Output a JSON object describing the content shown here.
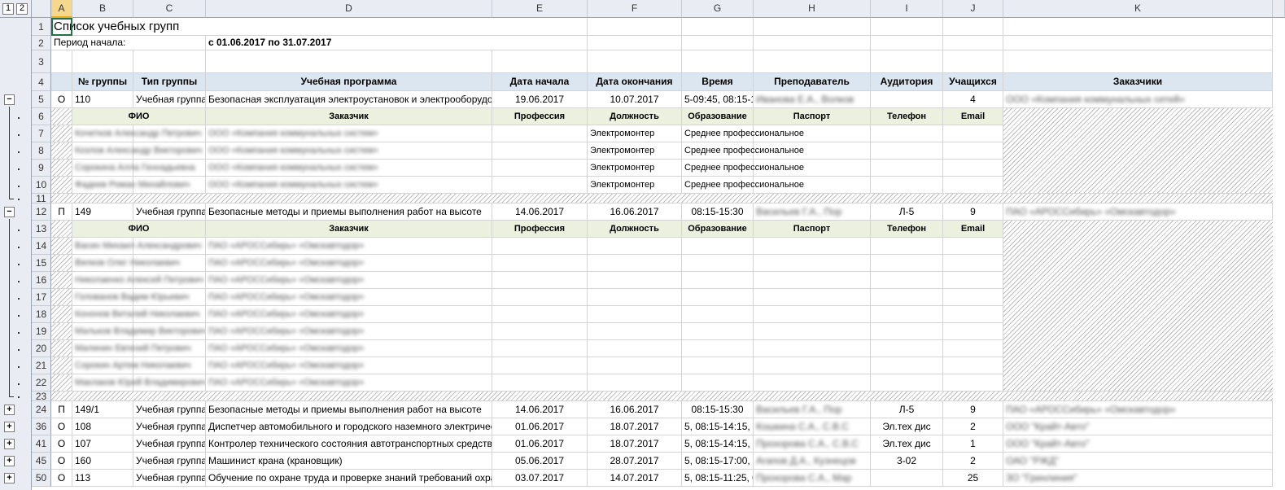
{
  "sheet": {
    "outline_levels": [
      "1",
      "2"
    ],
    "columns": [
      "A",
      "B",
      "C",
      "D",
      "E",
      "F",
      "G",
      "H",
      "I",
      "J",
      "K"
    ],
    "title": "Список учебных групп",
    "period_label": "Период начала:",
    "period_value": "с 01.06.2017 по 31.07.2017",
    "headers": [
      "№ группы",
      "Тип группы",
      "Учебная программа",
      "Дата начала",
      "Дата окончания",
      "Время",
      "Преподаватель",
      "Аудитория",
      "Учащихся",
      "Заказчики"
    ],
    "sub_headers": {
      "fio": "ФИО",
      "customer": "Заказчик",
      "profession": "Профессия",
      "position": "Должность",
      "education": "Образование",
      "passport": "Паспорт",
      "phone": "Телефон",
      "email": "Email"
    },
    "groups": [
      {
        "row": "5",
        "a": "О",
        "num": "110",
        "type": "Учебная группа",
        "program": "Безопасная эксплуатация электроустановок и электрооборудования",
        "start": "19.06.2017",
        "end": "10.07.2017",
        "time": "5-09:45, 08:15-1",
        "teacher": "Иванова Е.А., Волков",
        "room": "",
        "count": "4",
        "customer": "ООО «Компания коммунальных сетей»"
      },
      {
        "row": "12",
        "a": "П",
        "num": "149",
        "type": "Учебная группа",
        "program": "Безопасные методы и приемы выполнения работ на высоте",
        "start": "14.06.2017",
        "end": "16.06.2017",
        "time": "08:15-15:30",
        "teacher": "Васильев Г.А., Пор",
        "room": "Л-5",
        "count": "9",
        "customer": "ПАО «АРОССибирь» «Омскавтодор»"
      },
      {
        "row": "24",
        "a": "П",
        "num": "149/1",
        "type": "Учебная группа",
        "program": "Безопасные методы и приемы выполнения работ на высоте",
        "start": "14.06.2017",
        "end": "16.06.2017",
        "time": "08:15-15:30",
        "teacher": "Васильев Г.А., Пор",
        "room": "Л-5",
        "count": "9",
        "customer": "ПАО «АРОССибирь» «Омскавтодор»"
      },
      {
        "row": "36",
        "a": "О",
        "num": "108",
        "type": "Учебная группа",
        "program": "Диспетчер автомобильного и городского наземного электрического транспорта",
        "start": "01.06.2017",
        "end": "18.07.2017",
        "time": "5, 08:15-14:15, 0",
        "teacher": "Кошкина С.А., С.В.С",
        "room": "Эл.тех дис",
        "count": "2",
        "customer": "ООО \"Крайт-Авто\""
      },
      {
        "row": "41",
        "a": "О",
        "num": "107",
        "type": "Учебная группа",
        "program": "Контролер технического состояния автотранспортных средств",
        "start": "01.06.2017",
        "end": "18.07.2017",
        "time": "5, 08:15-14:15, 0",
        "teacher": "Прохорова С.А., С.В.С",
        "room": "Эл.тех дис",
        "count": "1",
        "customer": "ООО \"Крайт-Авто\""
      },
      {
        "row": "45",
        "a": "О",
        "num": "160",
        "type": "Учебная группа",
        "program": "Машинист  крана (крановщик)",
        "start": "05.06.2017",
        "end": "28.07.2017",
        "time": "5, 08:15-17:00, 0",
        "teacher": "Агапов Д.А., Кузнецов",
        "room": "3-02",
        "count": "2",
        "customer": "ОАО \"РЖД\""
      },
      {
        "row": "50",
        "a": "О",
        "num": "113",
        "type": "Учебная группа",
        "program": "Обучение по охране труда и проверке знаний требований охраны труда",
        "start": "03.07.2017",
        "end": "14.07.2017",
        "time": "5, 08:15-11:25, 0",
        "teacher": "Прохорова С.А., Мар",
        "room": "",
        "count": "25",
        "customer": "ЗО \"Гринлиния\""
      }
    ],
    "members_group1": [
      {
        "row": "7",
        "fio": "Кочетков Александр Петрович",
        "customer": "ООО «Компания коммунальных систем»",
        "position": "Электромонтер",
        "education": "Среднее профессиональное"
      },
      {
        "row": "8",
        "fio": "Козлов Александр Викторович",
        "customer": "ООО «Компания коммунальных систем»",
        "position": "Электромонтер",
        "education": "Среднее профессиональное"
      },
      {
        "row": "9",
        "fio": "Сорокина Алла Геннадьевна",
        "customer": "ООО «Компания коммунальных систем»",
        "position": "Электромонтер",
        "education": "Среднее профессиональное"
      },
      {
        "row": "10",
        "fio": "Фадеев Роман Михайлович",
        "customer": "ООО «Компания коммунальных систем»",
        "position": "Электромонтер",
        "education": "Среднее профессиональное"
      }
    ],
    "members_group2": [
      {
        "row": "14",
        "fio": "Васин Михаил Александрович",
        "customer": "ПАО «АРОССибирь» «Омскавтодор»"
      },
      {
        "row": "15",
        "fio": "Вялков Олег Николаевич",
        "customer": "ПАО «АРОССибирь» «Омскавтодор»"
      },
      {
        "row": "16",
        "fio": "Николаенко Алексей Петрович",
        "customer": "ПАО «АРОССибирь» «Омскавтодор»"
      },
      {
        "row": "17",
        "fio": "Голованов Вадим Юрьевич",
        "customer": "ПАО «АРОССибирь» «Омскавтодор»"
      },
      {
        "row": "18",
        "fio": "Кононов Виталий Николаевич",
        "customer": "ПАО «АРОССибирь» «Омскавтодор»"
      },
      {
        "row": "19",
        "fio": "Мальков Владимир Викторович",
        "customer": "ПАО «АРОССибирь» «Омскавтодор»"
      },
      {
        "row": "20",
        "fio": "Малинин Евгений Петрович",
        "customer": "ПАО «АРОССибирь» «Омскавтодор»"
      },
      {
        "row": "21",
        "fio": "Сорокин Артем Николаевич",
        "customer": "ПАО «АРОССибирь» «Омскавтодор»"
      },
      {
        "row": "22",
        "fio": "Маклаков Юрий Владимирович",
        "customer": "ПАО «АРОССибирь» «Омскавтодор»"
      }
    ],
    "row_numbers": [
      "1",
      "2",
      "3",
      "4",
      "6",
      "11",
      "13",
      "23"
    ]
  }
}
